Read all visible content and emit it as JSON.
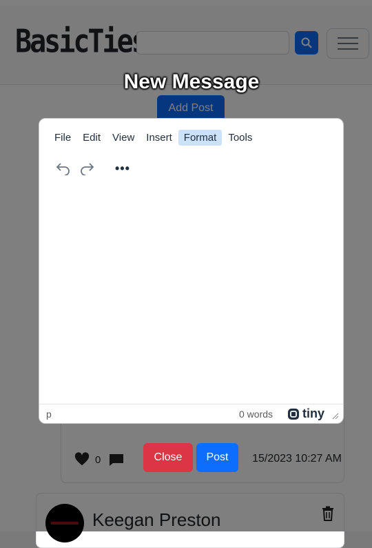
{
  "navbar": {
    "brand": "BasicTies",
    "search": {
      "value": "",
      "placeholder": ""
    },
    "icons": {
      "search": "search-icon",
      "menu": "hamburger-icon"
    }
  },
  "feed": {
    "add_post_label": "Add Post",
    "post": {
      "likes": "0",
      "timestamp": "15/2023 10:27 AM",
      "icons": {
        "like": "heart-icon",
        "comment": "comment-icon"
      }
    },
    "user": {
      "name": "Keegan Preston",
      "icons": {
        "delete": "trash-icon"
      }
    }
  },
  "dialog": {
    "title": "New Message",
    "menubar": [
      "File",
      "Edit",
      "View",
      "Insert",
      "Format",
      "Tools"
    ],
    "active_menu": "Format",
    "toolbar": {
      "icons": [
        "undo-icon",
        "redo-icon",
        "more-icon"
      ],
      "more_label": "•••"
    },
    "status": {
      "path": "p",
      "word_count": "0 words",
      "brand": "tiny"
    },
    "close_label": "Close",
    "post_label": "Post"
  },
  "colors": {
    "primary": "#0d6efd",
    "danger": "#dc3545",
    "menu_active": "#cce2fa"
  }
}
